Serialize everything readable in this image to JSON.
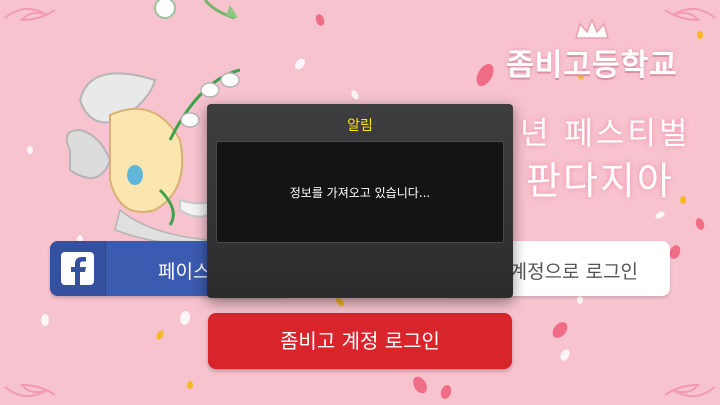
{
  "background": {
    "color": "#f7c3cf"
  },
  "logo": {
    "text": "좀비고등학교"
  },
  "festival": {
    "line1": "년 페스티벌",
    "line2": "판다지아"
  },
  "login": {
    "facebook_label": "페이스",
    "account_label": "계정으로 로그인",
    "zombie_label": "좀비고 계정 로그인"
  },
  "dialog": {
    "title": "알림",
    "message": "정보를 가져오고 있습니다..."
  },
  "colors": {
    "facebook": "#3b5bb0",
    "zombie_red": "#d8242b",
    "dialog_title": "#ffe800",
    "dialog_bg": "#2c2c2e"
  },
  "icons": {
    "facebook": "facebook-icon",
    "crown": "crown-icon",
    "character": "character-illustration"
  }
}
